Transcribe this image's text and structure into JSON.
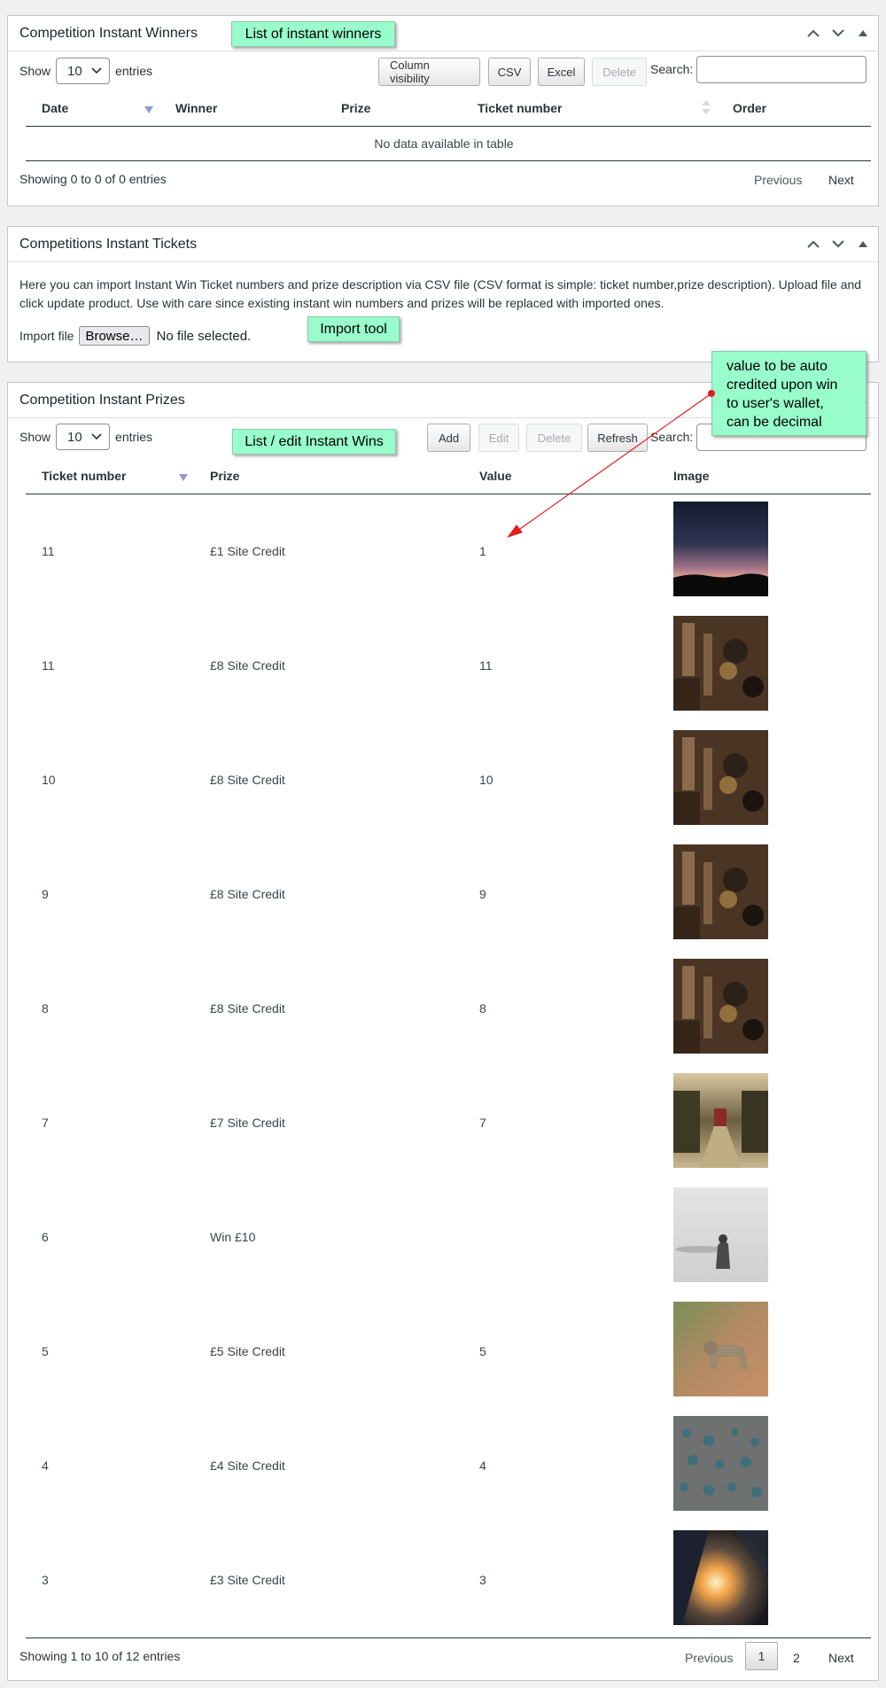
{
  "winners_box": {
    "title": "Competition Instant Winners",
    "show_label": "Show",
    "entries_label": "entries",
    "length_value": "10",
    "buttons": {
      "column_visibility": "Column visibility",
      "csv": "CSV",
      "excel": "Excel",
      "delete": "Delete"
    },
    "search_label": "Search:",
    "columns": [
      "Date",
      "Winner",
      "Prize",
      "Ticket number",
      "Order"
    ],
    "empty_message": "No data available in table",
    "info": "Showing 0 to 0 of 0 entries",
    "prev_label": "Previous",
    "next_label": "Next"
  },
  "tickets_box": {
    "title": "Competitions Instant Tickets",
    "description": "Here you can import Instant Win Ticket numbers and prize description via CSV file (CSV format is simple: ticket number,prize description). Upload file and click update product. Use with care since existing instant win numbers and prizes will be replaced with imported ones.",
    "import_label": "Import file",
    "browse_label": "Browse…",
    "no_file_label": "No file selected."
  },
  "prizes_box": {
    "title": "Competition Instant Prizes",
    "show_label": "Show",
    "entries_label": "entries",
    "length_value": "10",
    "buttons": {
      "add": "Add",
      "edit": "Edit",
      "delete": "Delete",
      "refresh": "Refresh"
    },
    "search_label": "Search:",
    "columns": [
      "Ticket number",
      "Prize",
      "Value",
      "Image"
    ],
    "rows": [
      {
        "ticket": "11",
        "prize": "£1 Site Credit",
        "value": "1",
        "image": "sunset-photo"
      },
      {
        "ticket": "11",
        "prize": "£8 Site Credit",
        "value": "11",
        "image": "tools-photo"
      },
      {
        "ticket": "10",
        "prize": "£8 Site Credit",
        "value": "10",
        "image": "tools-photo"
      },
      {
        "ticket": "9",
        "prize": "£8 Site Credit",
        "value": "9",
        "image": "tools-photo"
      },
      {
        "ticket": "8",
        "prize": "£8 Site Credit",
        "value": "8",
        "image": "tools-photo"
      },
      {
        "ticket": "7",
        "prize": "£7 Site Credit",
        "value": "7",
        "image": "market-photo"
      },
      {
        "ticket": "6",
        "prize": "Win £10",
        "value": "",
        "image": "foggy-figure-photo"
      },
      {
        "ticket": "5",
        "prize": "£5 Site Credit",
        "value": "5",
        "image": "leopard-photo"
      },
      {
        "ticket": "4",
        "prize": "£4 Site Credit",
        "value": "4",
        "image": "droplets-photo"
      },
      {
        "ticket": "3",
        "prize": "£3 Site Credit",
        "value": "3",
        "image": "train-sun-photo"
      }
    ],
    "info": "Showing 1 to 10 of 12 entries",
    "prev_label": "Previous",
    "pages": [
      "1",
      "2"
    ],
    "next_label": "Next"
  },
  "annotations": {
    "winners_note": "List of instant winners",
    "import_note": "Import tool",
    "prizes_note": "List / edit Instant Wins",
    "value_note": [
      "value to be auto",
      "credited upon win",
      "to user's wallet,",
      "can be decimal"
    ]
  },
  "colors": {
    "note_bg": "#98fccb",
    "sort_arrow": "#8e9acb",
    "arrow_line": "#e01f1f"
  }
}
